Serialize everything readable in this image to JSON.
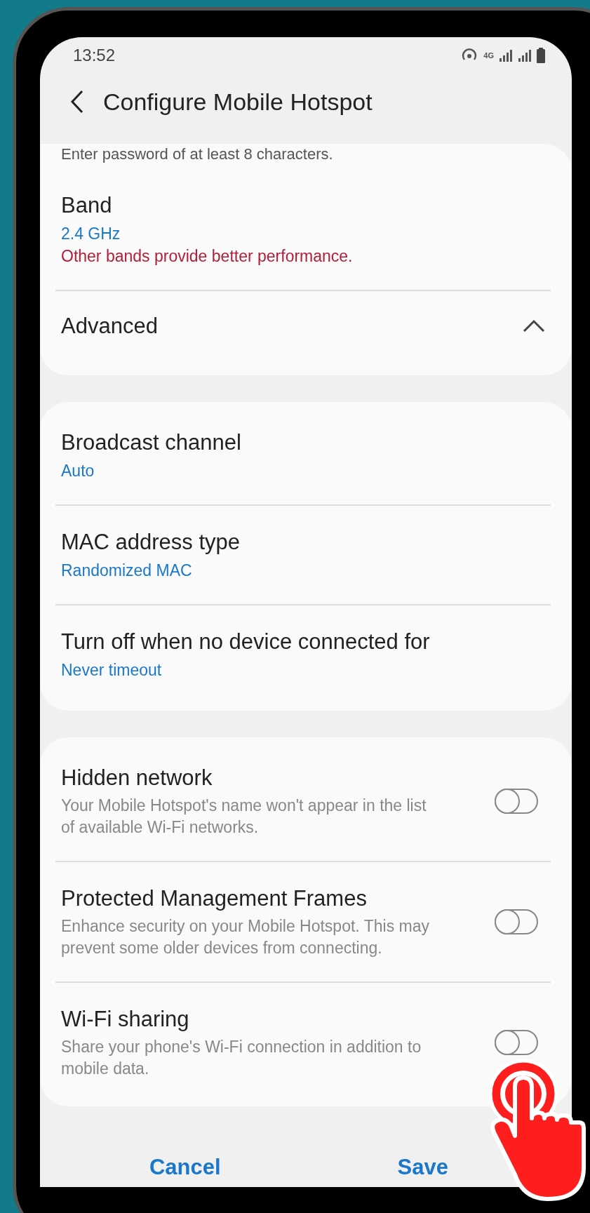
{
  "status_bar": {
    "time": "13:52",
    "network_label": "4G"
  },
  "header": {
    "title": "Configure Mobile Hotspot"
  },
  "password_hint": "Enter password of at least 8 characters.",
  "band": {
    "title": "Band",
    "value": "2.4 GHz",
    "warning": "Other bands provide better performance."
  },
  "advanced": {
    "title": "Advanced",
    "expanded": true
  },
  "advanced_settings": [
    {
      "title": "Broadcast channel",
      "value": "Auto"
    },
    {
      "title": "MAC address type",
      "value": "Randomized MAC"
    },
    {
      "title": "Turn off when no device connected for",
      "value": "Never timeout"
    }
  ],
  "toggles": [
    {
      "title": "Hidden network",
      "description": "Your Mobile Hotspot's name won't appear in the list of available Wi-Fi networks.",
      "checked": false
    },
    {
      "title": "Protected Management Frames",
      "description": "Enhance security on your Mobile Hotspot. This may prevent some older devices from connecting.",
      "checked": false
    },
    {
      "title": "Wi-Fi sharing",
      "description": "Share your phone's Wi-Fi connection in addition to mobile data.",
      "checked": false
    }
  ],
  "buttons": [
    {
      "label": "Cancel"
    },
    {
      "label": "Save"
    }
  ]
}
